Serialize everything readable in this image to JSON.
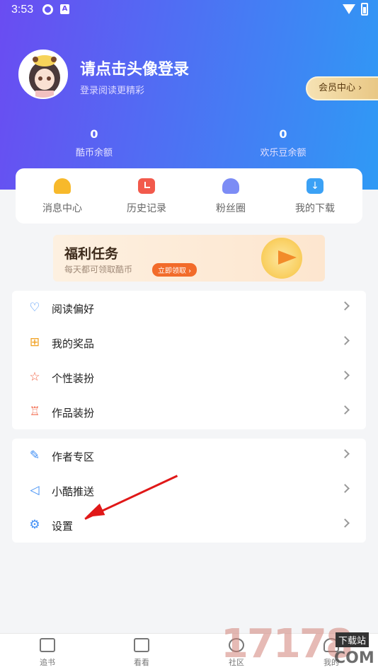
{
  "status_bar": {
    "time": "3:53"
  },
  "profile": {
    "title": "请点击头像登录",
    "subtitle": "登录阅读更精彩",
    "vip_button": "会员中心 ›"
  },
  "stats": [
    {
      "value": "0",
      "label": "酷币余额"
    },
    {
      "value": "0",
      "label": "欢乐豆余额"
    }
  ],
  "quick_actions": [
    {
      "label": "消息中心",
      "icon": "bell-icon"
    },
    {
      "label": "历史记录",
      "icon": "clock-icon"
    },
    {
      "label": "粉丝圈",
      "icon": "fans-icon"
    },
    {
      "label": "我的下载",
      "icon": "download-icon"
    }
  ],
  "banner": {
    "title": "福利任务",
    "subtitle": "每天都可领取酷币",
    "button": "立即领取 ›"
  },
  "menu_group1": [
    {
      "label": "阅读偏好",
      "icon": "heart-icon"
    },
    {
      "label": "我的奖品",
      "icon": "gift-icon"
    },
    {
      "label": "个性装扮",
      "icon": "star-icon"
    },
    {
      "label": "作品装扮",
      "icon": "shirt-icon"
    }
  ],
  "menu_group2": [
    {
      "label": "作者专区",
      "icon": "pen-icon"
    },
    {
      "label": "小酷推送",
      "icon": "speaker-icon"
    },
    {
      "label": "设置",
      "icon": "gear-icon"
    }
  ],
  "tabbar": [
    {
      "label": "追书",
      "icon": "book-icon"
    },
    {
      "label": "看看",
      "icon": "home-icon"
    },
    {
      "label": "社区",
      "icon": "community-icon"
    },
    {
      "label": "我的",
      "icon": "user-icon"
    }
  ],
  "watermark": {
    "number": "17178",
    "text": "下载站",
    "domain": "COM"
  },
  "colors": {
    "gradient_start": "#6a4cf2",
    "gradient_end": "#2f9af5",
    "arrow": "#e01818"
  }
}
